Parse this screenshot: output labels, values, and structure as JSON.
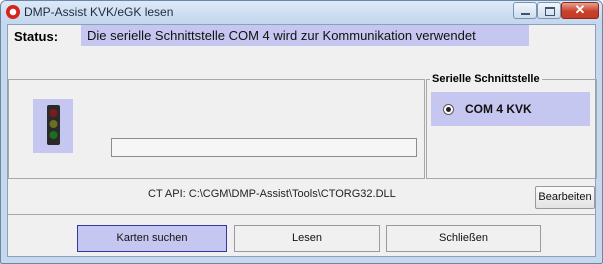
{
  "window": {
    "title": "DMP-Assist KVK/eGK lesen",
    "controls": {
      "minimize": "",
      "maximize": "",
      "close": "✕"
    }
  },
  "status": {
    "label": "Status:",
    "message": "Die serielle Schnittstelle COM 4 wird zur Kommunikation verwendet"
  },
  "serial": {
    "legend": "Serielle Schnittstelle",
    "option_label": "COM 4 KVK",
    "selected": true
  },
  "api": {
    "text": "CT API: C:\\CGM\\DMP-Assist\\Tools\\CTORG32.DLL"
  },
  "buttons": {
    "edit": "Bearbeiten",
    "search_cards": "Karten suchen",
    "read": "Lesen",
    "close": "Schließen"
  },
  "colors": {
    "highlight": "#c6c7f0",
    "title_bar": "#c4d7ee",
    "close_button": "#c8412b"
  },
  "icons": {
    "app": "app-icon",
    "traffic_light": "traffic-light-icon"
  },
  "traffic_light": {
    "top": "#7a1c1c",
    "middle": "#6e6e22",
    "bottom": "#1e6e22"
  },
  "progress": 0
}
